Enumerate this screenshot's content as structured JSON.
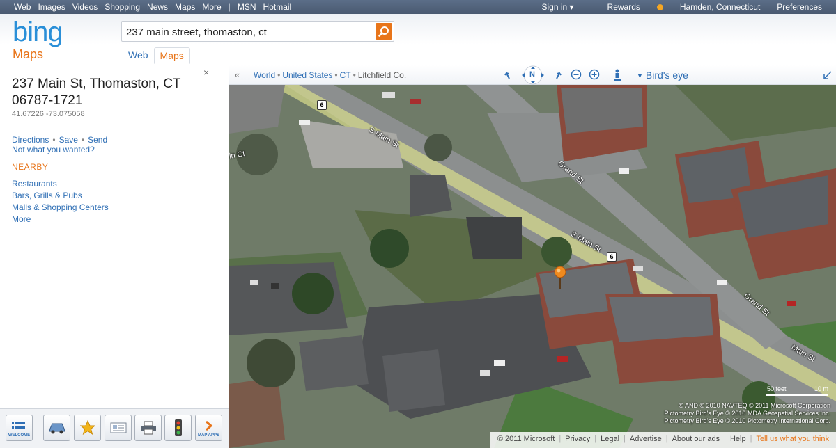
{
  "topnav": {
    "left": [
      "Web",
      "Images",
      "Videos",
      "Shopping",
      "News",
      "Maps",
      "More"
    ],
    "separator": "|",
    "left2": [
      "MSN",
      "Hotmail"
    ],
    "signin": "Sign in ▾",
    "rewards": "Rewards",
    "location": "Hamden, Connecticut",
    "preferences": "Preferences"
  },
  "header": {
    "logo": "bing",
    "section": "Maps",
    "search_value": "237 main street, thomaston, ct",
    "tabs": [
      {
        "label": "Web",
        "active": false
      },
      {
        "label": "Maps",
        "active": true
      }
    ]
  },
  "result": {
    "close": "×",
    "address_line1": "237 Main St, Thomaston, CT",
    "address_line2": "06787-1721",
    "coords": "41.67226 -73.075058",
    "actions": [
      "Directions",
      "Save",
      "Send"
    ],
    "not_wanted": "Not what you wanted?",
    "nearby_heading": "NEARBY",
    "nearby": [
      "Restaurants",
      "Bars, Grills & Pubs",
      "Malls & Shopping Centers",
      "More"
    ]
  },
  "toolbar": {
    "buttons": [
      {
        "name": "welcome",
        "label": "WELCOME",
        "icon": "list-icon"
      },
      {
        "name": "traffic-car",
        "label": "",
        "icon": "car-icon"
      },
      {
        "name": "favorites",
        "label": "",
        "icon": "star-icon"
      },
      {
        "name": "business-card",
        "label": "",
        "icon": "card-icon"
      },
      {
        "name": "print",
        "label": "",
        "icon": "printer-icon"
      },
      {
        "name": "traffic",
        "label": "",
        "icon": "traffic-light-icon"
      },
      {
        "name": "map-apps",
        "label": "MAP APPS",
        "icon": "chevron-right-icon"
      }
    ]
  },
  "map": {
    "breadcrumb": [
      "World",
      "United States",
      "CT",
      "Litchfield Co."
    ],
    "view_mode": "Bird's eye",
    "compass_n": "N",
    "street_labels": [
      "S Main St",
      "S Main St",
      "Grand St",
      "Grand St",
      "Main St",
      "in Ct"
    ],
    "route_shield": "6",
    "scale_feet": "50 feet",
    "scale_m": "10 m",
    "credits": [
      "© AND © 2010 NAVTEQ © 2011 Microsoft Corporation",
      "Pictometry Bird's Eye © 2010 MDA Geospatial Services Inc.",
      "Pictometry Bird's Eye © 2010 Pictometry International Corp."
    ],
    "footer": [
      "© 2011 Microsoft",
      "Privacy",
      "Legal",
      "Advertise",
      "About our ads",
      "Help",
      "Tell us what you think"
    ]
  },
  "colors": {
    "accent_orange": "#e8751a",
    "link_blue": "#2f6fb5",
    "logo_blue": "#2a8fd8",
    "route_yellow": "#e6e87a"
  }
}
